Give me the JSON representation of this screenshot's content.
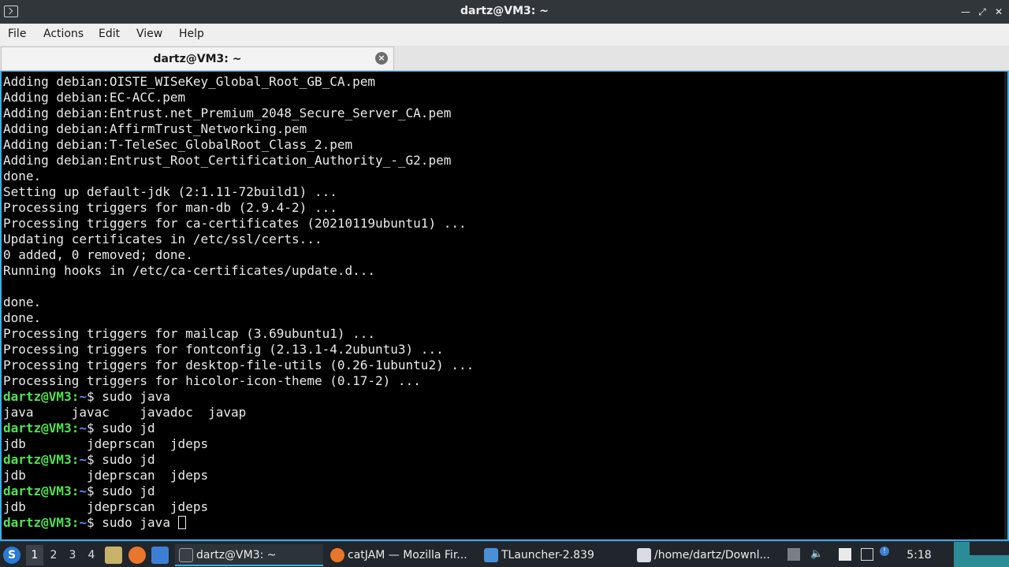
{
  "window": {
    "title": "dartz@VM3: ~"
  },
  "menu": {
    "items": [
      "File",
      "Actions",
      "Edit",
      "View",
      "Help"
    ]
  },
  "tabs": [
    {
      "label": "dartz@VM3: ~",
      "close_icon": "close-icon"
    }
  ],
  "terminal": {
    "lines": [
      {
        "type": "out",
        "text": "Adding debian:OISTE_WISeKey_Global_Root_GB_CA.pem"
      },
      {
        "type": "out",
        "text": "Adding debian:EC-ACC.pem"
      },
      {
        "type": "out",
        "text": "Adding debian:Entrust.net_Premium_2048_Secure_Server_CA.pem"
      },
      {
        "type": "out",
        "text": "Adding debian:AffirmTrust_Networking.pem"
      },
      {
        "type": "out",
        "text": "Adding debian:T-TeleSec_GlobalRoot_Class_2.pem"
      },
      {
        "type": "out",
        "text": "Adding debian:Entrust_Root_Certification_Authority_-_G2.pem"
      },
      {
        "type": "out",
        "text": "done."
      },
      {
        "type": "out",
        "text": "Setting up default-jdk (2:1.11-72build1) ..."
      },
      {
        "type": "out",
        "text": "Processing triggers for man-db (2.9.4-2) ..."
      },
      {
        "type": "out",
        "text": "Processing triggers for ca-certificates (20210119ubuntu1) ..."
      },
      {
        "type": "out",
        "text": "Updating certificates in /etc/ssl/certs..."
      },
      {
        "type": "out",
        "text": "0 added, 0 removed; done."
      },
      {
        "type": "out",
        "text": "Running hooks in /etc/ca-certificates/update.d..."
      },
      {
        "type": "out",
        "text": ""
      },
      {
        "type": "out",
        "text": "done."
      },
      {
        "type": "out",
        "text": "done."
      },
      {
        "type": "out",
        "text": "Processing triggers for mailcap (3.69ubuntu1) ..."
      },
      {
        "type": "out",
        "text": "Processing triggers for fontconfig (2.13.1-4.2ubuntu3) ..."
      },
      {
        "type": "out",
        "text": "Processing triggers for desktop-file-utils (0.26-1ubuntu2) ..."
      },
      {
        "type": "out",
        "text": "Processing triggers for hicolor-icon-theme (0.17-2) ..."
      },
      {
        "type": "prompt",
        "user": "dartz@VM3",
        "sep": ":",
        "path": "~",
        "sym": "$ ",
        "cmd": "sudo java"
      },
      {
        "type": "out",
        "text": "java     javac    javadoc  javap"
      },
      {
        "type": "prompt",
        "user": "dartz@VM3",
        "sep": ":",
        "path": "~",
        "sym": "$ ",
        "cmd": "sudo jd"
      },
      {
        "type": "out",
        "text": "jdb        jdeprscan  jdeps"
      },
      {
        "type": "prompt",
        "user": "dartz@VM3",
        "sep": ":",
        "path": "~",
        "sym": "$ ",
        "cmd": "sudo jd"
      },
      {
        "type": "out",
        "text": "jdb        jdeprscan  jdeps"
      },
      {
        "type": "prompt",
        "user": "dartz@VM3",
        "sep": ":",
        "path": "~",
        "sym": "$ ",
        "cmd": "sudo jd"
      },
      {
        "type": "out",
        "text": "jdb        jdeprscan  jdeps"
      },
      {
        "type": "prompt",
        "user": "dartz@VM3",
        "sep": ":",
        "path": "~",
        "sym": "$ ",
        "cmd": "sudo java ",
        "cursor": true
      }
    ]
  },
  "taskbar": {
    "workspaces": [
      "1",
      "2",
      "3",
      "4"
    ],
    "active_workspace": "1",
    "tasks": [
      {
        "label": "dartz@VM3: ~",
        "icon": "terminal-icon",
        "active": true
      },
      {
        "label": "catJAM — Mozilla Fir...",
        "icon": "firefox-icon",
        "active": false
      },
      {
        "label": "TLauncher-2.839",
        "icon": "folder-icon",
        "active": false
      },
      {
        "label": "/home/dartz/Downl...",
        "icon": "text-editor-icon",
        "active": false
      }
    ],
    "clock": "5:18"
  },
  "colors": {
    "accent": "#3daee9",
    "prompt_user": "#4fe34f",
    "prompt_path": "#5c8ff0",
    "terminal_bg": "#000000"
  }
}
